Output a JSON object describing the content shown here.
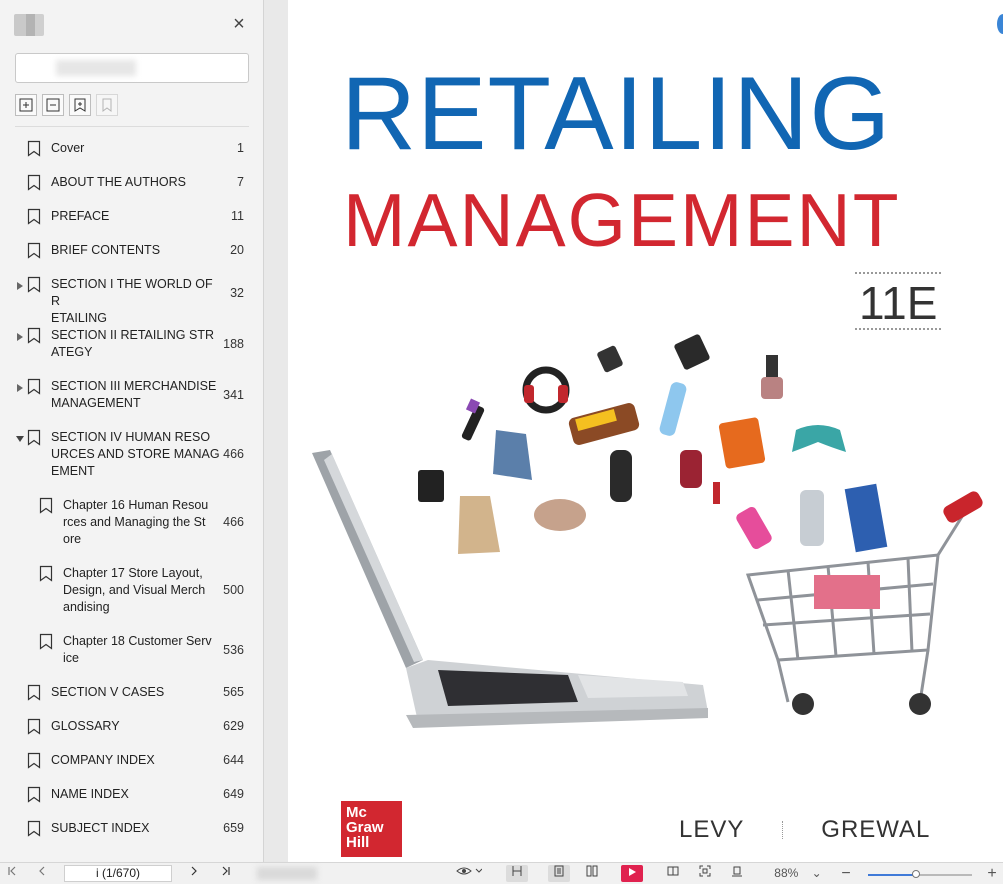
{
  "sidebar": {
    "search": {
      "value": "",
      "placeholder": ""
    },
    "bookmarks": [
      {
        "label": "Cover",
        "page": "1",
        "level": 0,
        "expand": "none"
      },
      {
        "label": "ABOUT THE AUTHORS",
        "page": "7",
        "level": 0,
        "expand": "none"
      },
      {
        "label": "PREFACE",
        "page": "11",
        "level": 0,
        "expand": "none"
      },
      {
        "label": "BRIEF CONTENTS",
        "page": "20",
        "level": 0,
        "expand": "none"
      },
      {
        "label": "SECTION I THE WORLD OF R\nETAILING",
        "page": "32",
        "level": 0,
        "expand": "collapsed"
      },
      {
        "label": "SECTION II RETAILING STR\nATEGY",
        "page": "188",
        "level": 0,
        "expand": "collapsed"
      },
      {
        "label": "SECTION III MERCHANDISE\nMANAGEMENT",
        "page": "341",
        "level": 0,
        "expand": "collapsed"
      },
      {
        "label": "SECTION IV HUMAN RESO\nURCES AND STORE MANAG\nEMENT",
        "page": "466",
        "level": 0,
        "expand": "expanded"
      },
      {
        "label": "Chapter 16 Human Resou\nrces and Managing the St\nore",
        "page": "466",
        "level": 1,
        "expand": "none"
      },
      {
        "label": "Chapter 17 Store Layout,\nDesign, and Visual Merch\nandising",
        "page": "500",
        "level": 1,
        "expand": "none"
      },
      {
        "label": "Chapter 18 Customer Serv\nice",
        "page": "536",
        "level": 1,
        "expand": "none"
      },
      {
        "label": "SECTION V CASES",
        "page": "565",
        "level": 0,
        "expand": "none"
      },
      {
        "label": "GLOSSARY",
        "page": "629",
        "level": 0,
        "expand": "none"
      },
      {
        "label": "COMPANY INDEX",
        "page": "644",
        "level": 0,
        "expand": "none"
      },
      {
        "label": "NAME INDEX",
        "page": "649",
        "level": 0,
        "expand": "none"
      },
      {
        "label": "SUBJECT INDEX",
        "page": "659",
        "level": 0,
        "expand": "none"
      }
    ]
  },
  "document": {
    "title_line1": "RETAILING",
    "title_line2": "MANAGEMENT",
    "edition": "11E",
    "publisher_logo": [
      "Mc",
      "Graw",
      "Hill"
    ],
    "author1": "LEVY",
    "author2": "GREWAL"
  },
  "status": {
    "page_indicator": "i (1/670)",
    "zoom": "88%",
    "zoom_level": 0.46
  },
  "colors": {
    "title_blue": "#1166b3",
    "title_red": "#d22730",
    "play_accent": "#e0224f",
    "zoom_accent": "#3f7ad8"
  }
}
